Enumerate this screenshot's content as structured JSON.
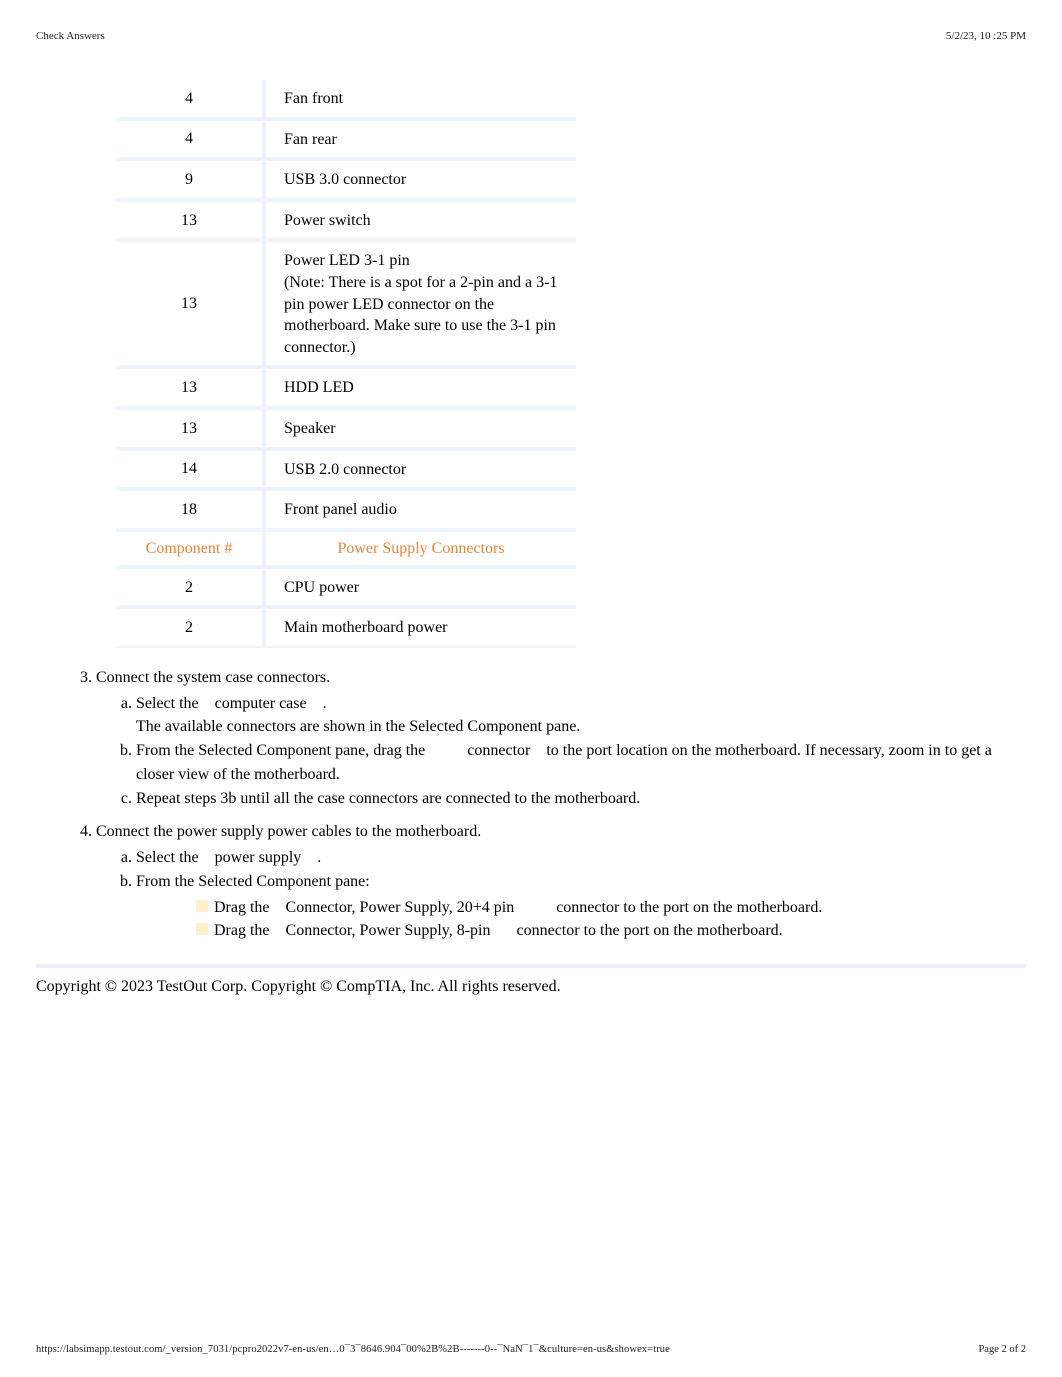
{
  "header": {
    "left": "Check Answers",
    "right": "5/2/23, 10 :25 PM"
  },
  "table1": {
    "rows": [
      {
        "num": "4",
        "desc": "Fan front"
      },
      {
        "num": "4",
        "desc": "Fan rear"
      },
      {
        "num": "9",
        "desc": "USB 3.0 connector"
      },
      {
        "num": "13",
        "desc": "Power switch"
      },
      {
        "num": "13",
        "desc": "Power LED 3-1 pin\n(Note: There is a spot for a 2-pin and a 3-1 pin power LED connector on the motherboard. Make sure to use the 3-1 pin connector.)"
      },
      {
        "num": "13",
        "desc": "HDD LED"
      },
      {
        "num": "13",
        "desc": "Speaker"
      },
      {
        "num": "14",
        "desc": "USB 2.0 connector"
      },
      {
        "num": "18",
        "desc": "Front panel audio"
      }
    ]
  },
  "table2": {
    "headers": {
      "num": "Component #",
      "desc": "Power Supply Connectors"
    },
    "rows": [
      {
        "num": "2",
        "desc": "CPU power"
      },
      {
        "num": "2",
        "desc": "Main motherboard power"
      }
    ]
  },
  "steps": {
    "s3": {
      "title": "Connect the system case connectors.",
      "a": {
        "lead": "Select  the",
        "term": "computer case",
        "tail": "."
      },
      "a_cont": "The available connectors are shown in the Selected Component pane.",
      "b": {
        "lead": "From the Selected Component pane, drag the",
        "mid": "connector",
        "tail": "to the port location on the motherboard. If necessary, zoom in to get a closer view of the motherboard."
      },
      "c": "Repeat steps 3b until all the case connectors are connected to the motherboard."
    },
    "s4": {
      "title": "Connect the power supply power cables to the motherboard.",
      "a": {
        "lead": "Select  the",
        "term": "power supply",
        "tail": "."
      },
      "b_intro": "From the Selected Component pane:",
      "b1": {
        "lead": "Drag the",
        "term": "Connector, Power Supply, 20+4 pin",
        "tail": "connector to the port on the motherboard."
      },
      "b2": {
        "lead": "Drag the",
        "term": "Connector, Power Supply, 8-pin",
        "tail": "connector to the port on the motherboard."
      }
    }
  },
  "copyright": "Copyright © 2023 TestOut Corp. Copyright © CompTIA, Inc. All rights reserved.",
  "footer": {
    "left": "https://labsimapp.testout.com/_version_7031/pcpro2022v7-en-us/en…0¯3¯8646.904¯00%2B%2B-------0--¯NaN¯1¯&culture=en-us&showex=true",
    "right": "Page 2 of 2"
  }
}
